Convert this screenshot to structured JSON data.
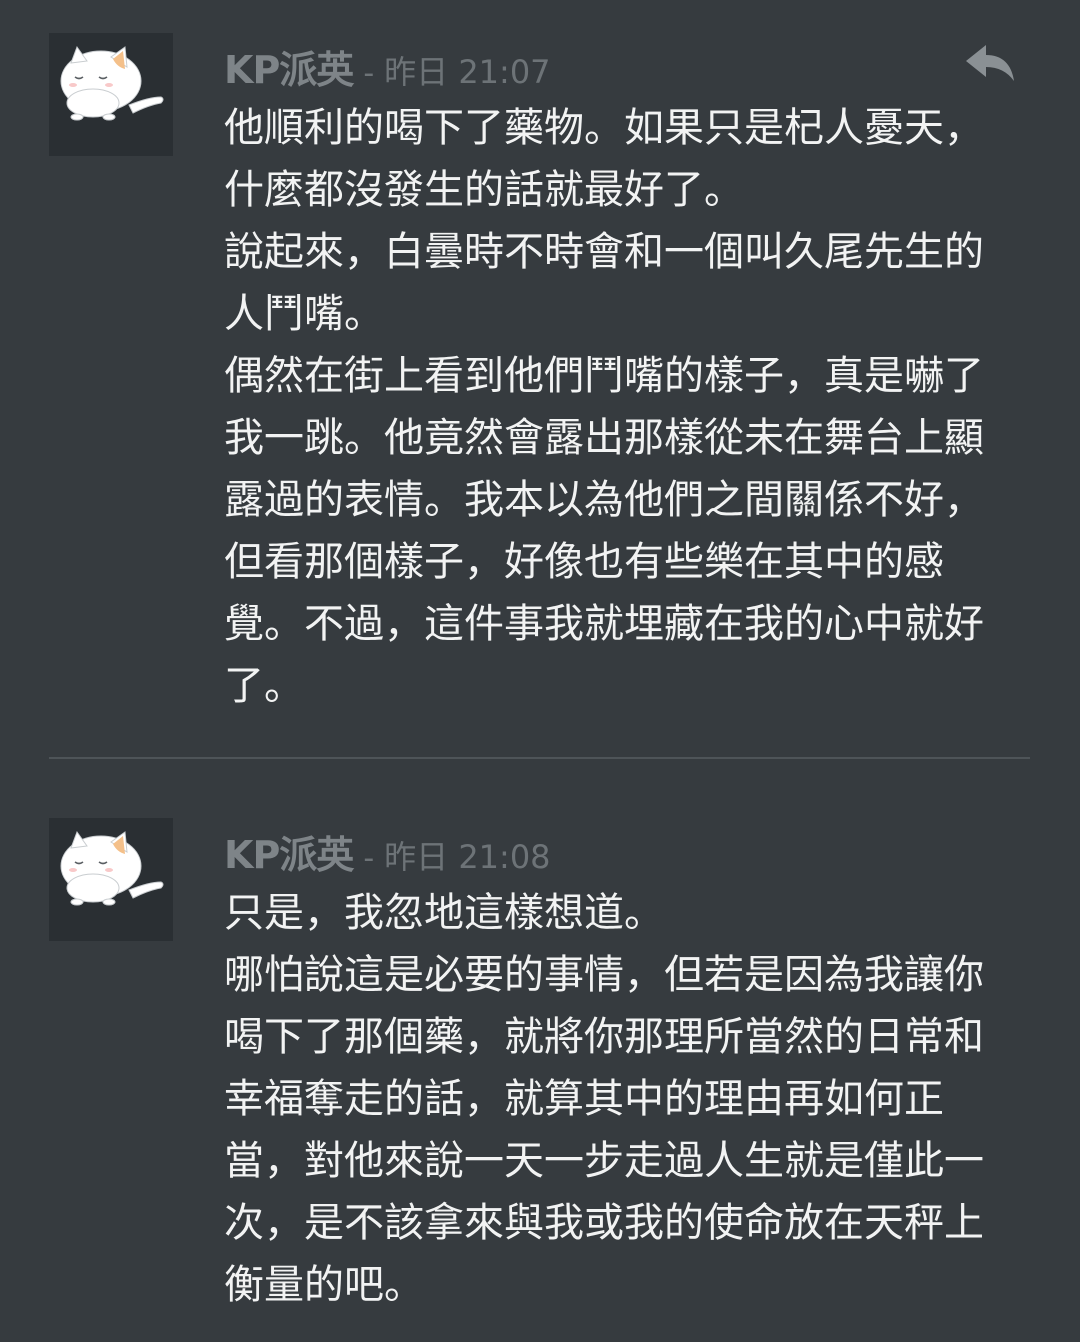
{
  "messages": [
    {
      "author": "KP派英",
      "separator": "-",
      "timestamp": "昨日 21:07",
      "avatar_icon": "white-cat-avatar-icon",
      "reply_icon": "reply-arrow-icon",
      "lines": [
        "他順利的喝下了藥物。如果只是杞人憂天，",
        "什麼都沒發生的話就最好了。",
        "說起來，白曇時不時會和一個叫久尾先生的",
        "人鬥嘴。",
        "偶然在街上看到他們鬥嘴的樣子，真是嚇了",
        "我一跳。他竟然會露出那樣從未在舞台上顯",
        "露過的表情。我本以為他們之間關係不好，",
        "但看那個樣子，好像也有些樂在其中的感",
        "覺。不過，這件事我就埋藏在我的心中就好",
        "了。"
      ]
    },
    {
      "author": "KP派英",
      "separator": "-",
      "timestamp": "昨日 21:08",
      "avatar_icon": "white-cat-avatar-icon",
      "lines": [
        "只是，我忽地這樣想道。",
        "哪怕說這是必要的事情，但若是因為我讓你",
        "喝下了那個藥，就將你那理所當然的日常和",
        "幸福奪走的話，就算其中的理由再如何正",
        "當，對他來說一天一步走過人生就是僅此一",
        "次，是不該拿來與我或我的使命放在天秤上",
        "衡量的吧。"
      ]
    }
  ],
  "colors": {
    "background": "#363b3f",
    "avatar_bg": "#2a2f33",
    "author": "#7e8488",
    "timestamp": "#6d7377",
    "body_text": "#f2f3f3",
    "divider": "#4e5458",
    "reply_icon": "#8a9094"
  }
}
